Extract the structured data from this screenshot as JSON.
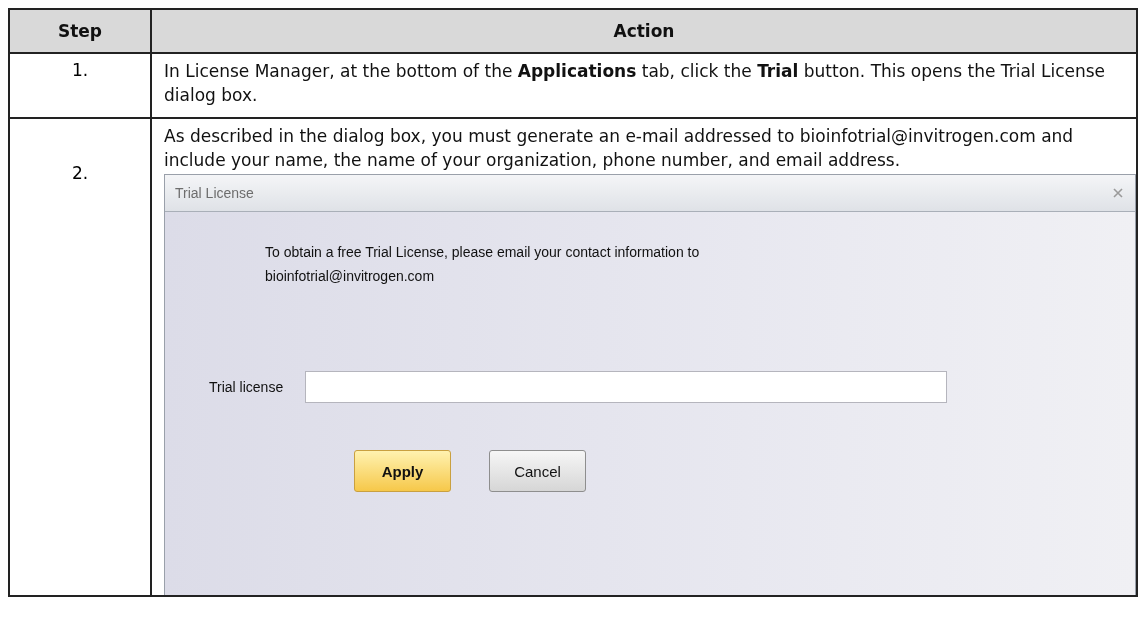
{
  "table": {
    "columns": [
      "Step",
      "Action"
    ],
    "rows": [
      {
        "step": "1.",
        "text": "In License Manager, at the bottom of the **Applications** tab, click the **Trial** button. This opens the Trial License dialog box."
      },
      {
        "step": "2.",
        "text": "As described in the dialog box, you must generate an e-mail addressed to bioinfotrial@invitrogen.com and include your name, the name of your organization, phone number, and email address.",
        "dialog": {
          "title": "Trial License",
          "message": "To obtain a free Trial License, please email your contact information to\nbioinfotrial@invitrogen.com",
          "field_label": "Trial license",
          "buttons": [
            {
              "label": "Apply",
              "default": true
            },
            {
              "label": "Cancel",
              "default": false
            }
          ]
        }
      }
    ]
  }
}
